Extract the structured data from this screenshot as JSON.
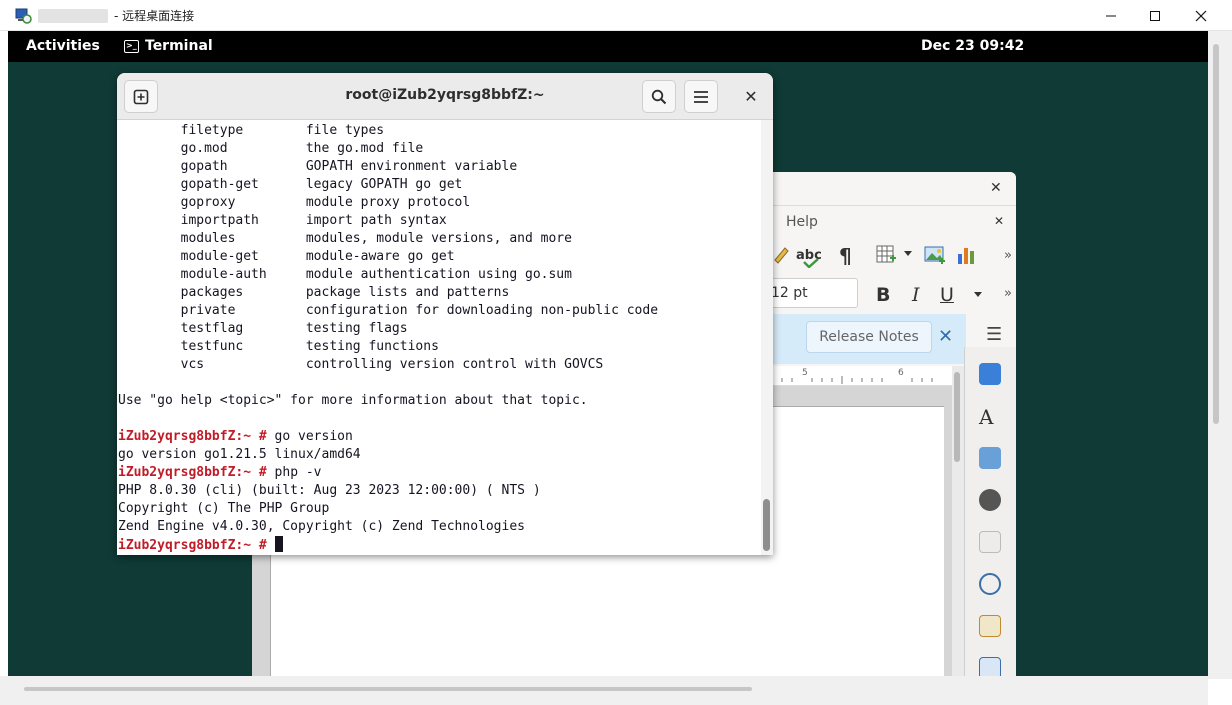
{
  "rdp": {
    "title": "- 远程桌面连接",
    "min_icon": "minimize-icon",
    "max_icon": "maximize-icon",
    "close_icon": "close-icon"
  },
  "gnome": {
    "activities": "Activities",
    "app_name": "Terminal",
    "clock": "Dec 23  09:42"
  },
  "terminal": {
    "title": "root@iZub2yqrsg8bbfZ:~",
    "close_glyph": "✕",
    "lines": [
      {
        "prompt": "",
        "text": "        filetype        file types"
      },
      {
        "prompt": "",
        "text": "        go.mod          the go.mod file"
      },
      {
        "prompt": "",
        "text": "        gopath          GOPATH environment variable"
      },
      {
        "prompt": "",
        "text": "        gopath-get      legacy GOPATH go get"
      },
      {
        "prompt": "",
        "text": "        goproxy         module proxy protocol"
      },
      {
        "prompt": "",
        "text": "        importpath      import path syntax"
      },
      {
        "prompt": "",
        "text": "        modules         modules, module versions, and more"
      },
      {
        "prompt": "",
        "text": "        module-get      module-aware go get"
      },
      {
        "prompt": "",
        "text": "        module-auth     module authentication using go.sum"
      },
      {
        "prompt": "",
        "text": "        packages        package lists and patterns"
      },
      {
        "prompt": "",
        "text": "        private         configuration for downloading non-public code"
      },
      {
        "prompt": "",
        "text": "        testflag        testing flags"
      },
      {
        "prompt": "",
        "text": "        testfunc        testing functions"
      },
      {
        "prompt": "",
        "text": "        vcs             controlling version control with GOVCS"
      },
      {
        "prompt": "",
        "text": ""
      },
      {
        "prompt": "",
        "text": "Use \"go help <topic>\" for more information about that topic."
      },
      {
        "prompt": "",
        "text": ""
      },
      {
        "prompt": "iZub2yqrsg8bbfZ:~ #",
        "text": " go version"
      },
      {
        "prompt": "",
        "text": "go version go1.21.5 linux/amd64"
      },
      {
        "prompt": "iZub2yqrsg8bbfZ:~ #",
        "text": " php -v"
      },
      {
        "prompt": "",
        "text": "PHP 8.0.30 (cli) (built: Aug 23 2023 12:00:00) ( NTS )"
      },
      {
        "prompt": "",
        "text": "Copyright (c) The PHP Group"
      },
      {
        "prompt": "",
        "text": "Zend Engine v4.0.30, Copyright (c) Zend Technologies"
      },
      {
        "prompt": "iZub2yqrsg8bbfZ:~ #",
        "text": " ",
        "cursor": true
      }
    ]
  },
  "writer": {
    "close_glyph": "✕",
    "menu_help": "Help",
    "menu_close_glyph": "✕",
    "font_size": "12 pt",
    "bold": "B",
    "italic": "I",
    "underline": "U",
    "release_notes": "Release Notes",
    "infobar_close": "✕",
    "sidebar_menu": "☰",
    "more": "»",
    "ruler_5": "5",
    "ruler_6": "6",
    "spellcheck_label": "abc",
    "paragraph_mark": "¶"
  }
}
